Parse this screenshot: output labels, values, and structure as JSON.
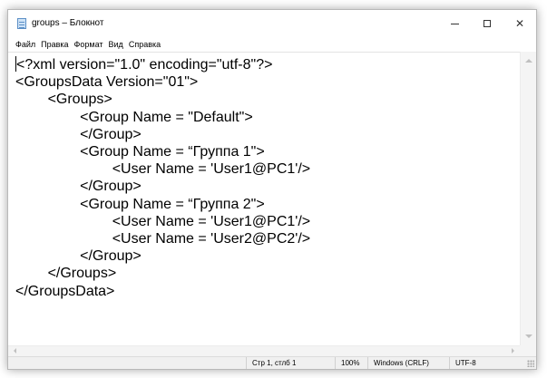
{
  "window": {
    "title": "groups – Блокнот",
    "controls": {
      "minimize_icon": "minimize-icon",
      "maximize_icon": "maximize-icon",
      "close_icon": "close-icon",
      "close_glyph": "✕"
    }
  },
  "menu": {
    "items": [
      "Файл",
      "Правка",
      "Формат",
      "Вид",
      "Справка"
    ]
  },
  "editor": {
    "lines": [
      "<?xml version=\"1.0\" encoding=\"utf-8\"?>",
      "<GroupsData Version=\"01\">",
      "\t<Groups>",
      "\t\t<Group Name = \"Default\">",
      "\t\t</Group>",
      "\t\t<Group Name = “Группа 1\">",
      "\t\t\t<User Name = 'User1@PC1'/>",
      "\t\t</Group>",
      "\t\t<Group Name = “Группа 2\">",
      "\t\t\t<User Name = 'User1@PC1'/>",
      "\t\t\t<User Name = 'User2@PC2'/>",
      "\t\t</Group>",
      "\t</Groups>",
      "</GroupsData>"
    ]
  },
  "statusbar": {
    "position": "Стр 1, стлб 1",
    "zoom": "100%",
    "line_ending": "Windows (CRLF)",
    "encoding": "UTF-8"
  }
}
